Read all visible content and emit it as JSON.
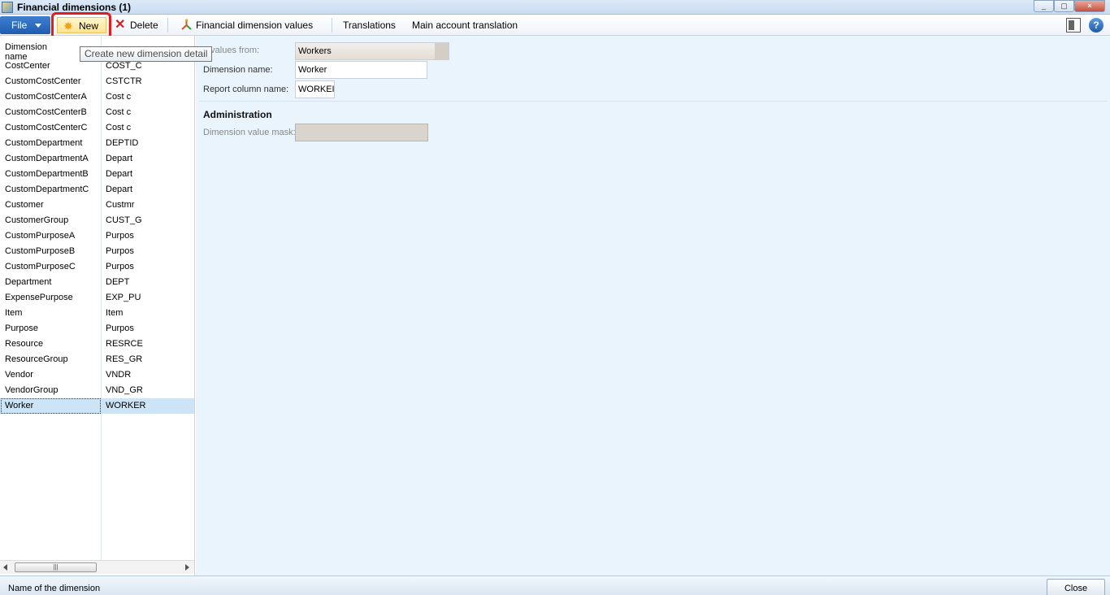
{
  "window": {
    "title": "Financial dimensions (1)",
    "min": "_",
    "restore": "▢",
    "close": "×"
  },
  "toolbar": {
    "file_label": "File",
    "new_label": "New",
    "delete_label": "Delete",
    "fdv_label": "Financial dimension values",
    "translations_label": "Translations",
    "main_account_translation_label": "Main account translation",
    "help_glyph": "?"
  },
  "tooltip": {
    "text": "Create new dimension detail"
  },
  "grid": {
    "header": {
      "dimension_name": "Dimension name"
    },
    "rows": [
      {
        "name": "CostCenter",
        "code": "COST_C"
      },
      {
        "name": "CustomCostCenter",
        "code": "CSTCTR"
      },
      {
        "name": "CustomCostCenterA",
        "code": "Cost c"
      },
      {
        "name": "CustomCostCenterB",
        "code": "Cost c"
      },
      {
        "name": "CustomCostCenterC",
        "code": "Cost c"
      },
      {
        "name": "CustomDepartment",
        "code": "DEPTID"
      },
      {
        "name": "CustomDepartmentA",
        "code": "Depart"
      },
      {
        "name": "CustomDepartmentB",
        "code": "Depart"
      },
      {
        "name": "CustomDepartmentC",
        "code": "Depart"
      },
      {
        "name": "Customer",
        "code": "Custmr"
      },
      {
        "name": "CustomerGroup",
        "code": "CUST_G"
      },
      {
        "name": "CustomPurposeA",
        "code": "Purpos"
      },
      {
        "name": "CustomPurposeB",
        "code": "Purpos"
      },
      {
        "name": "CustomPurposeC",
        "code": "Purpos"
      },
      {
        "name": "Department",
        "code": "DEPT"
      },
      {
        "name": "ExpensePurpose",
        "code": "EXP_PU"
      },
      {
        "name": "Item",
        "code": "Item"
      },
      {
        "name": "Purpose",
        "code": "Purpos"
      },
      {
        "name": "Resource",
        "code": "RESRCE"
      },
      {
        "name": "ResourceGroup",
        "code": "RES_GR"
      },
      {
        "name": "Vendor",
        "code": "VNDR"
      },
      {
        "name": "VendorGroup",
        "code": "VND_GR"
      },
      {
        "name": "Worker",
        "code": "WORKER"
      }
    ],
    "selected_index": 22,
    "scroll_thumb_glyph": "|||"
  },
  "detail": {
    "use_values_from_label": "e values from:",
    "use_values_from_value": "Workers",
    "dimension_name_label": "Dimension name:",
    "dimension_name_value": "Worker",
    "report_column_name_label": "Report column name:",
    "report_column_name_value": "WORKEI",
    "administration_title": "Administration",
    "dimension_value_mask_label": "Dimension value mask:",
    "dimension_value_mask_value": ""
  },
  "statusbar": {
    "text": "Name of the dimension",
    "close_label": "Close"
  }
}
